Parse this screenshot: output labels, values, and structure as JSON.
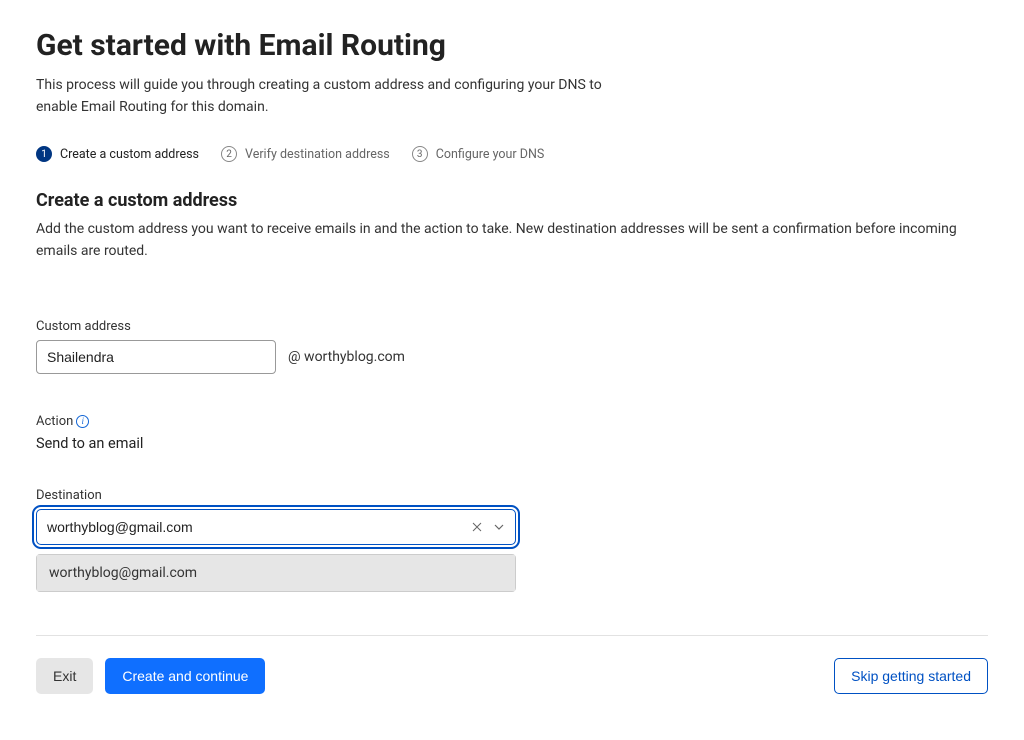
{
  "header": {
    "title": "Get started with Email Routing",
    "description": "This process will guide you through creating a custom address and configuring your DNS to enable Email Routing for this domain."
  },
  "steps": [
    {
      "num": "1",
      "label": "Create a custom address",
      "active": true
    },
    {
      "num": "2",
      "label": "Verify destination address",
      "active": false
    },
    {
      "num": "3",
      "label": "Configure your DNS",
      "active": false
    }
  ],
  "section": {
    "title": "Create a custom address",
    "description": "Add the custom address you want to receive emails in and the action to take. New destination addresses will be sent a confirmation before incoming emails are routed."
  },
  "customAddress": {
    "label": "Custom address",
    "value": "Shailendra",
    "domain": "@  worthyblog.com"
  },
  "action": {
    "label": "Action",
    "value": "Send to an email"
  },
  "destination": {
    "label": "Destination",
    "value": "worthyblog@gmail.com",
    "options": [
      "worthyblog@gmail.com"
    ]
  },
  "footer": {
    "exit": "Exit",
    "createContinue": "Create and continue",
    "skip": "Skip getting started"
  }
}
